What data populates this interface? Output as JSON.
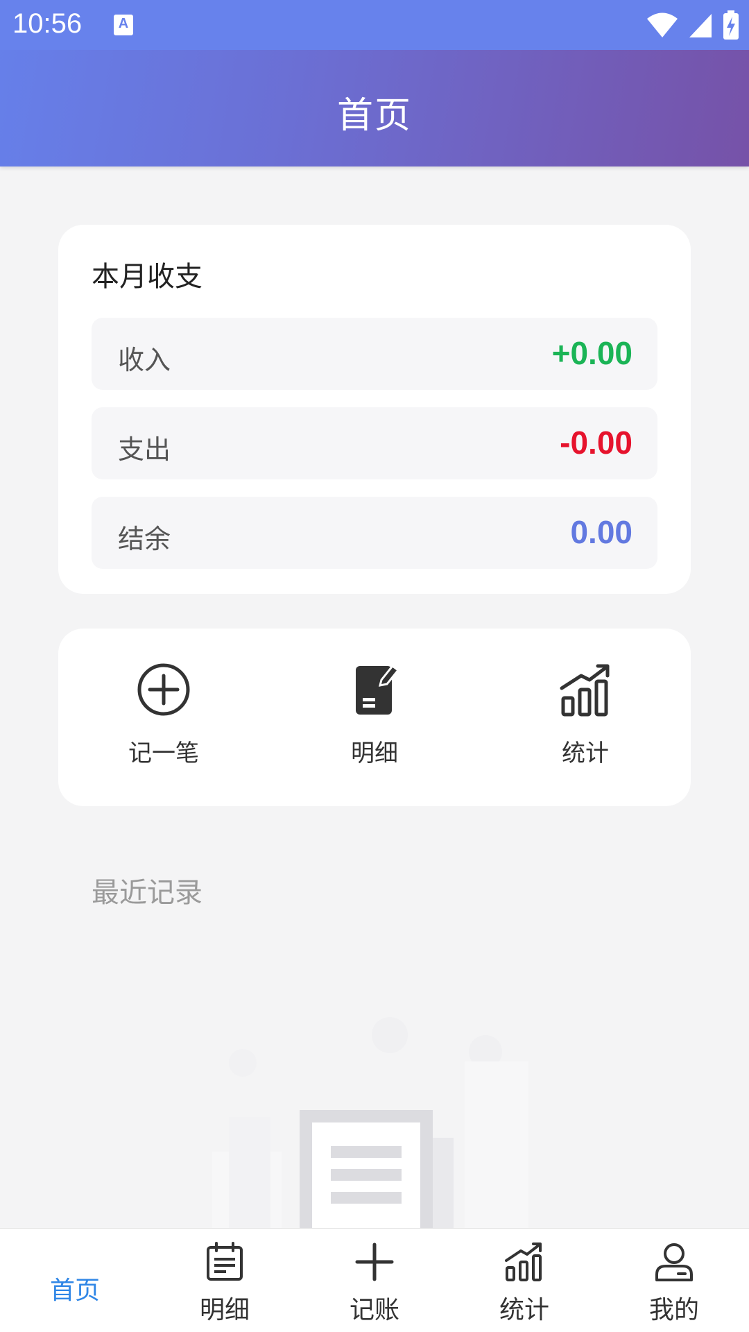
{
  "status_bar": {
    "time": "10:56",
    "notification_icon": "a-notification-icon",
    "icons": [
      "wifi-icon",
      "signal-icon",
      "battery-charging-icon"
    ]
  },
  "header": {
    "title": "首页"
  },
  "summary": {
    "title": "本月收支",
    "rows": [
      {
        "label": "收入",
        "value": "+0.00",
        "color": "#1bb456"
      },
      {
        "label": "支出",
        "value": "-0.00",
        "color": "#e6132d"
      },
      {
        "label": "结余",
        "value": "0.00",
        "color": "#6279e0"
      }
    ]
  },
  "quick_actions": [
    {
      "label": "记一笔",
      "icon": "add-circle-icon"
    },
    {
      "label": "明细",
      "icon": "note-edit-icon"
    },
    {
      "label": "统计",
      "icon": "bar-chart-icon"
    }
  ],
  "recent": {
    "title": "最近记录",
    "empty_icon": "empty-records-illustration"
  },
  "bottom_nav": {
    "items": [
      {
        "label": "首页",
        "icon": "",
        "active": true
      },
      {
        "label": "明细",
        "icon": "calendar-list-icon",
        "active": false
      },
      {
        "label": "记账",
        "icon": "plus-icon",
        "active": false
      },
      {
        "label": "统计",
        "icon": "bar-chart-icon",
        "active": false
      },
      {
        "label": "我的",
        "icon": "user-icon",
        "active": false
      }
    ]
  },
  "colors": {
    "header_start": "#6680ea",
    "header_end": "#7652a8",
    "nav_active": "#2f86e6"
  }
}
